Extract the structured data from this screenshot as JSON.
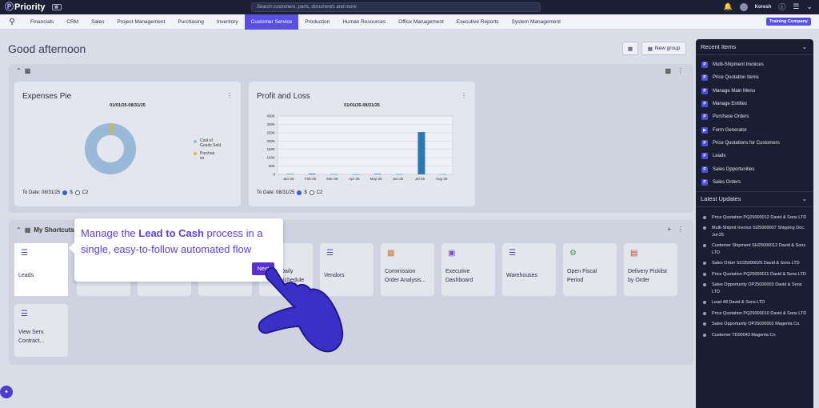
{
  "topbar": {
    "brand": "Priority",
    "search_placeholder": "Search customers, parts, documents and more",
    "user": "Koresh"
  },
  "menu": {
    "items": [
      "Financials",
      "CRM",
      "Sales",
      "Project Management",
      "Purchasing",
      "Inventory",
      "Customer Service",
      "Production",
      "Human Resources",
      "Office Management",
      "Executive Reports",
      "System Management"
    ],
    "active_index": 6,
    "company": "Training Company"
  },
  "main": {
    "greeting": "Good afternoon",
    "new_group": "New group"
  },
  "expenses_pie": {
    "title": "Expenses Pie",
    "date_range": "01/01/25-08/31/25",
    "footer_label": "To Date: 08/31/25",
    "opt_dollar": "$",
    "opt_c2": "C2"
  },
  "profit_loss": {
    "title": "Profit and Loss",
    "date_range": "01/01/25-08/31/25",
    "footer_label": "To Date: 08/31/25",
    "opt_dollar": "$",
    "opt_c2": "C2"
  },
  "chart_data": [
    {
      "type": "pie",
      "title": "Expenses Pie",
      "categories": [
        "Cost of Goods Sold",
        "Purchases"
      ],
      "values": [
        98,
        2
      ],
      "legend": [
        "Cost of Goods Sold",
        "Purchas es"
      ],
      "colors": [
        "#9ab8d8",
        "#d8b83a"
      ]
    },
    {
      "type": "bar",
      "title": "Profit and Loss",
      "categories": [
        "Jan-25",
        "Feb-25",
        "Mar-25",
        "Apr-25",
        "May-25",
        "Jun-25",
        "Jul-25",
        "Aug-25"
      ],
      "values": [
        3,
        5,
        2,
        1,
        4,
        2,
        290,
        2
      ],
      "ylim": [
        0,
        400
      ],
      "yticks": [
        "0",
        "50K",
        "100K",
        "150K",
        "200K",
        "250K",
        "300K",
        "400K"
      ],
      "color": "#2d78b4"
    }
  ],
  "shortcuts": {
    "title": "My Shortcuts",
    "tiles": [
      "Leads",
      "Vendors",
      "Commission Order Analysis...",
      "Executive Dashboard",
      "Warehouses",
      "Open Fiscal Period",
      "Delivery Picklist by Order",
      "View Serv. Contract..."
    ],
    "partial_tile": "Daily Schedule"
  },
  "tooltip": {
    "t1": "Manage the ",
    "t2": "Lead to Cash",
    "t3": " process in a single, easy-to-follow automated flow",
    "next": "Next"
  },
  "recent": {
    "title": "Recent Items",
    "items": [
      "Multi-Shipment Invoices",
      "Price Quotation Items",
      "Manage Main Menu",
      "Manage Entities",
      "Purchase Orders",
      "Form Generator",
      "Price Quotations for Customers",
      "Leads",
      "Sales Opportunities",
      "Sales Orders"
    ]
  },
  "updates": {
    "title": "Latest Updates",
    "items": [
      "Price Quotation PQ25000012 David & Sons LTD",
      "Multi-Shipmt Invoice SI25000007 Shipping Doc. Jul-25",
      "Customer Shipment SH25000012 David & Sons LTD",
      "Sales Order SO25000026 David & Sons LTD",
      "Price Quotation PQ25000011 David & Sons LTD",
      "Sales Opportunity OP25000003 David & Sons LTD",
      "Lead 48 David & Sons LTD",
      "Price Quotation PQ25000010 David & Sons LTD",
      "Sales Opportunity OP25000002 Magenta Co.",
      "Customer TD00043 Magenta Co."
    ]
  }
}
